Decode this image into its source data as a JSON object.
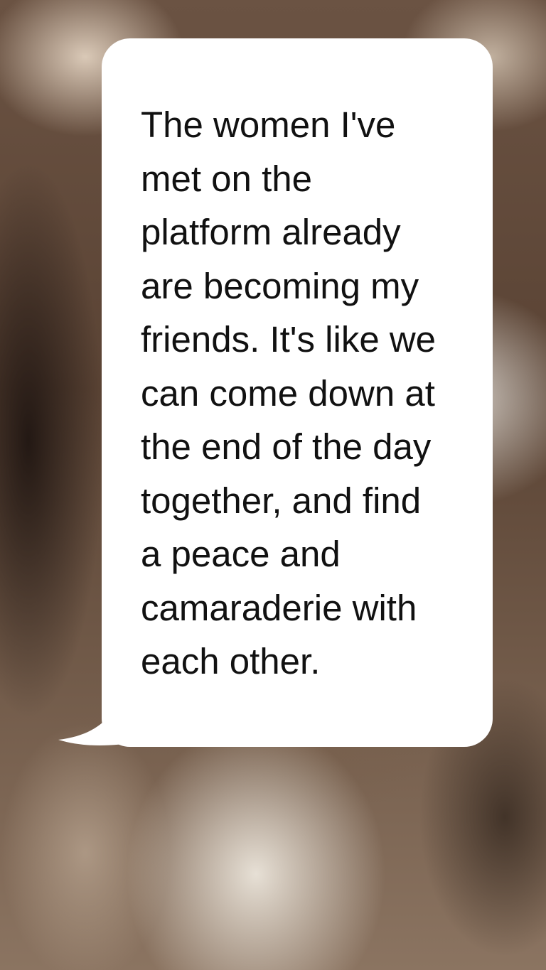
{
  "quote": {
    "text": "The women I've\nmet on the\nplatform already\nare becoming my\nfriends. It's like we\ncan come down at\nthe end of the day\ntogether, and find\na peace and\ncamaraderie with\neach other."
  },
  "colors": {
    "bubble": "#ffffff",
    "text": "#111111"
  }
}
